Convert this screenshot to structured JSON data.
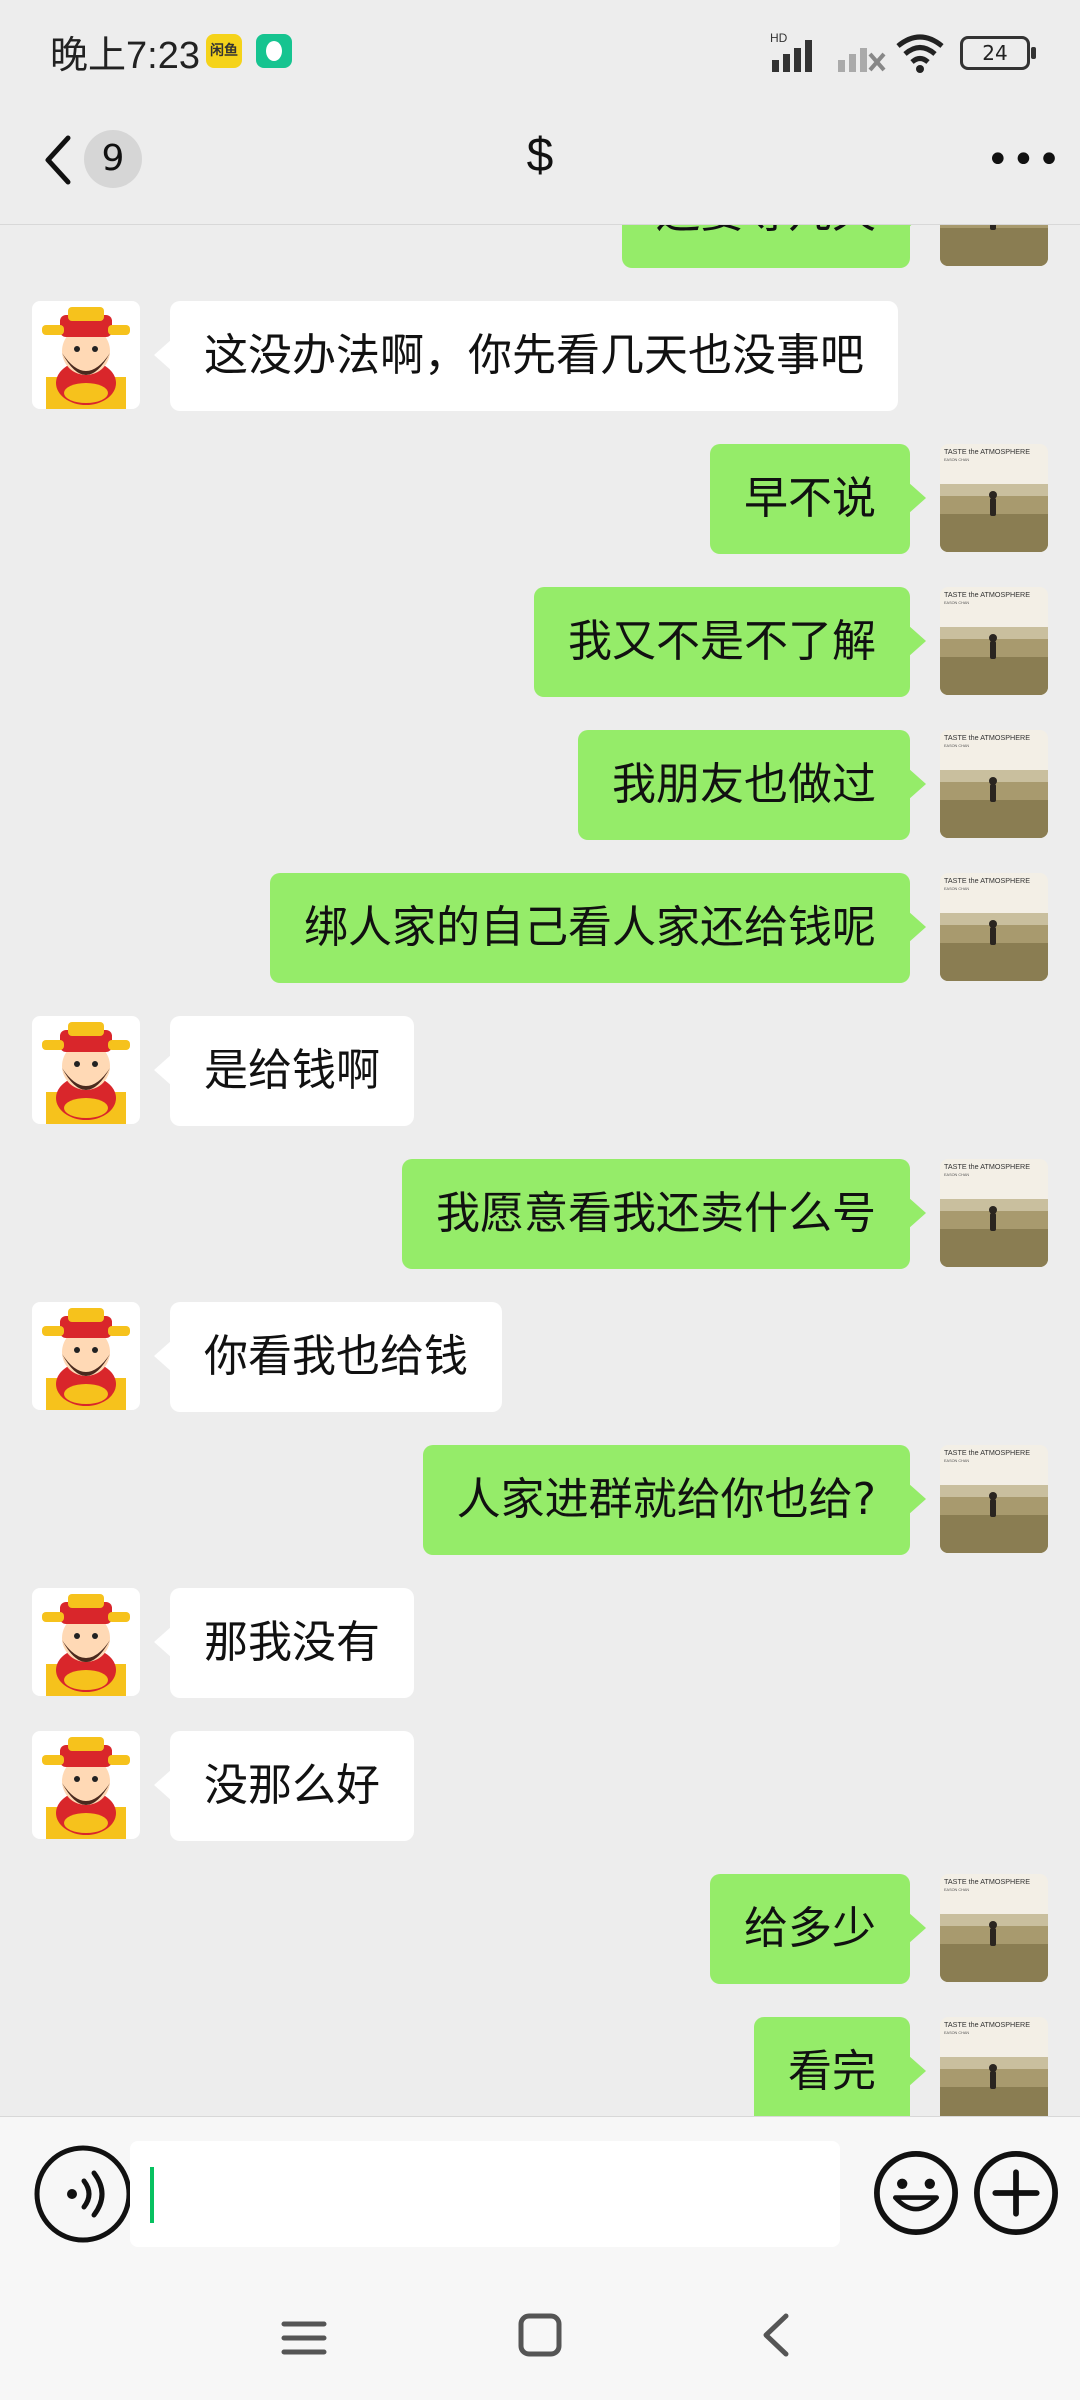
{
  "status_bar": {
    "time": "晚上7:23",
    "app_icon_1": "xianyu-app-icon",
    "app_icon_1_text": "闲鱼",
    "app_icon_2": "security-app-icon",
    "network_label": "HD",
    "battery": "24"
  },
  "nav": {
    "unread_count": "9",
    "title": "$",
    "more_label": "•••"
  },
  "messages": [
    {
      "side": "out",
      "text": "还要等几天"
    },
    {
      "side": "in",
      "text": "这没办法啊，你先看几天也没事吧"
    },
    {
      "side": "out",
      "text": "早不说"
    },
    {
      "side": "out",
      "text": "我又不是不了解"
    },
    {
      "side": "out",
      "text": "我朋友也做过"
    },
    {
      "side": "out",
      "text": "绑人家的自己看人家还给钱呢"
    },
    {
      "side": "in",
      "text": "是给钱啊"
    },
    {
      "side": "out",
      "text": "我愿意看我还卖什么号"
    },
    {
      "side": "in",
      "text": "你看我也给钱"
    },
    {
      "side": "out",
      "text": "人家进群就给你也给?"
    },
    {
      "side": "in",
      "text": "那我没有"
    },
    {
      "side": "in",
      "text": "没那么好"
    },
    {
      "side": "out",
      "text": "给多少"
    },
    {
      "side": "out",
      "text": "看完"
    }
  ],
  "self_avatar": {
    "caption_line1": "TASTE the ATMOSPHERE",
    "caption_line2": "EASON CHAN"
  },
  "input": {
    "value": "",
    "placeholder": ""
  },
  "colors": {
    "background": "#ededed",
    "outgoing_bubble": "#95ec69",
    "incoming_bubble": "#ffffff",
    "caret": "#07c160"
  }
}
